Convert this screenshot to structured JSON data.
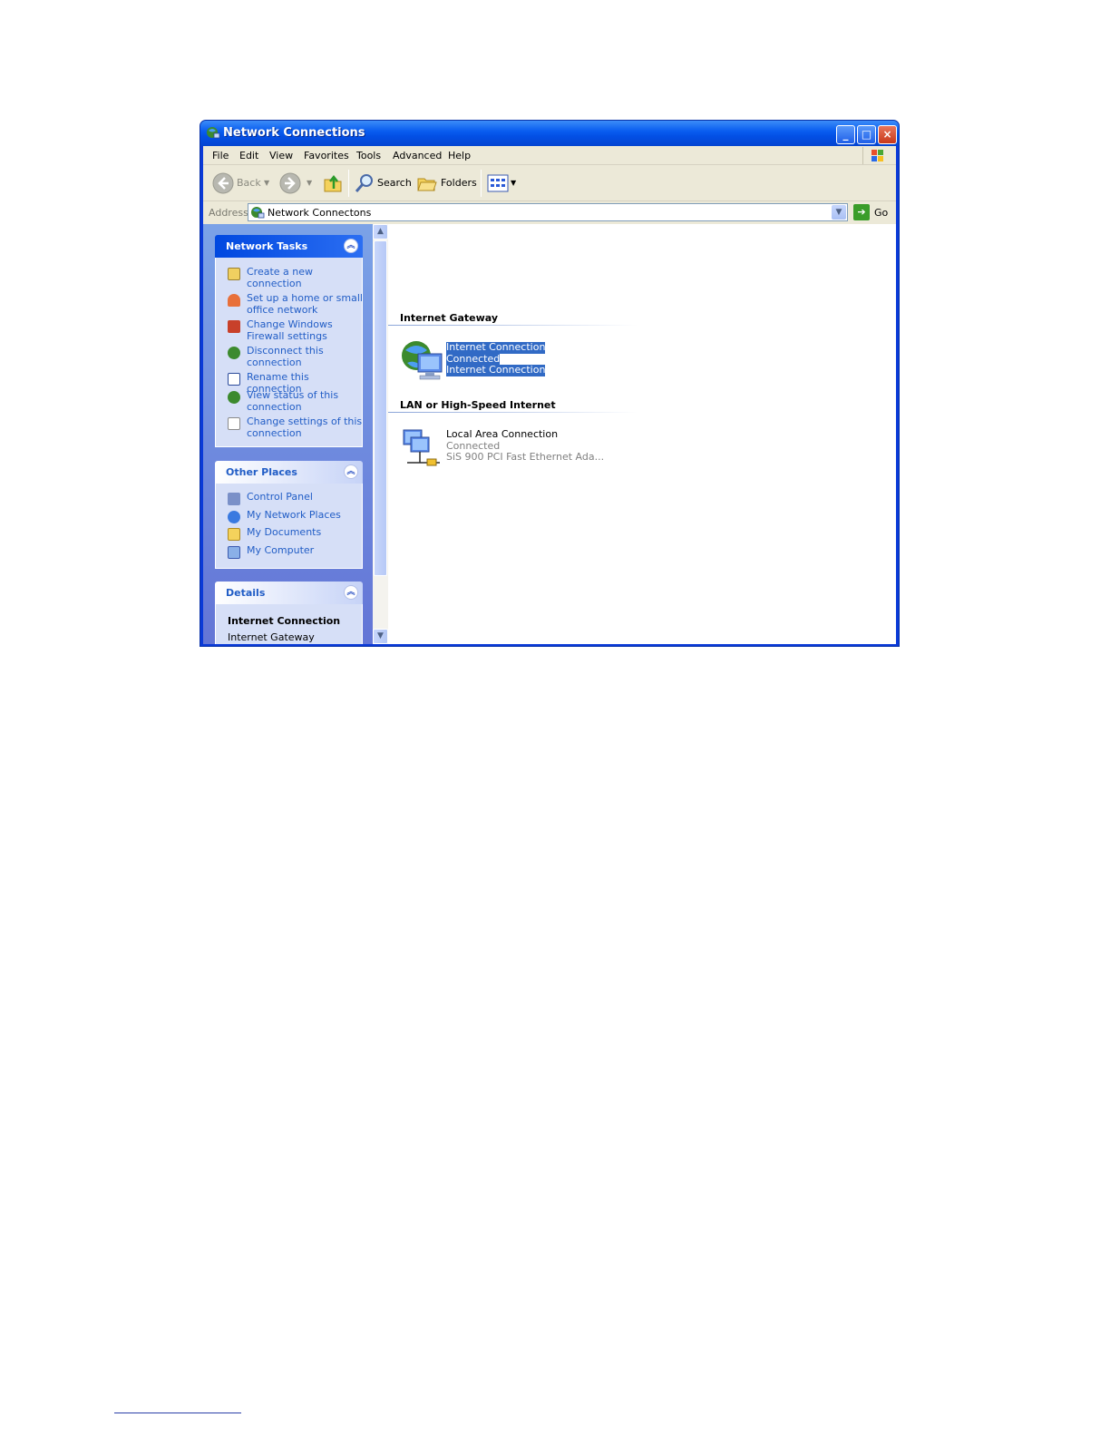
{
  "window": {
    "title": "Network Connections"
  },
  "menu": [
    "File",
    "Edit",
    "View",
    "Favorites",
    "Tools",
    "Advanced",
    "Help"
  ],
  "toolbar": {
    "back": "Back",
    "search": "Search",
    "folders": "Folders"
  },
  "address": {
    "label": "Address",
    "value": "Network Connectons",
    "go": "Go"
  },
  "network_tasks": {
    "title": "Network Tasks",
    "items": [
      "Create a new connection",
      "Set up a home or small office network",
      "Change Windows Firewall settings",
      "Disconnect this connection",
      "Rename this connection",
      "View status of this connection",
      "Change settings of this connection"
    ]
  },
  "other_places": {
    "title": "Other Places",
    "items": [
      "Control Panel",
      "My Network Places",
      "My Documents",
      "My Computer"
    ]
  },
  "details": {
    "title": "Details",
    "name": "Internet Connection",
    "type": "Internet Gateway"
  },
  "groups": [
    {
      "title": "Internet Gateway",
      "connection": {
        "name": "Internet Connection",
        "status": "Connected",
        "device": "Internet Connection"
      }
    },
    {
      "title": "LAN or High-Speed Internet",
      "connection": {
        "name": "Local Area Connection",
        "status": "Connected",
        "device": "SiS 900 PCI Fast Ethernet Ada..."
      }
    }
  ],
  "colors": {
    "title_bar": "#0a5ef0",
    "task_link": "#215dc6",
    "selection": "#316ac5",
    "task_pane": "#7ba2e7"
  }
}
